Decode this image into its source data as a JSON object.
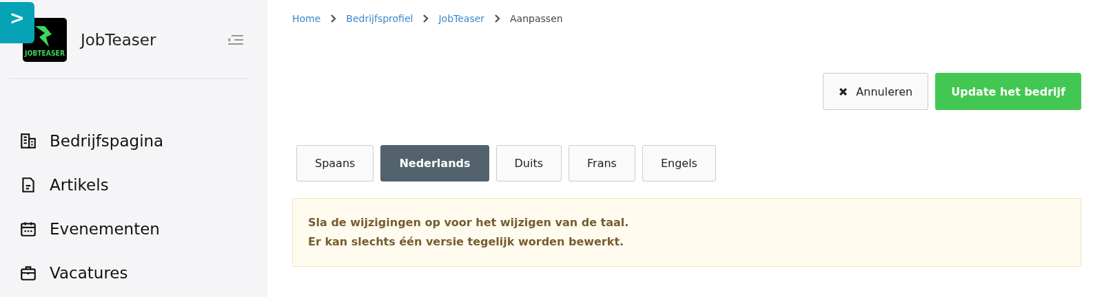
{
  "sidebar": {
    "toggle_button": ">",
    "logo_text": "JOBTEASER",
    "title": "JobTeaser",
    "items": [
      {
        "label": "Bedrijfspagina",
        "kind": "building"
      },
      {
        "label": "Artikels",
        "kind": "document"
      },
      {
        "label": "Evenementen",
        "kind": "calendar"
      },
      {
        "label": "Vacatures",
        "kind": "briefcase"
      }
    ]
  },
  "breadcrumb": [
    {
      "label": "Home",
      "current": false
    },
    {
      "label": "Bedrijfsprofiel",
      "current": false
    },
    {
      "label": "JobTeaser",
      "current": false
    },
    {
      "label": "Aanpassen",
      "current": true
    }
  ],
  "actions": {
    "cancel": "Annuleren",
    "submit": "Update het bedrijf"
  },
  "tabs": [
    {
      "label": "Spaans",
      "selected": false
    },
    {
      "label": "Nederlands",
      "selected": true
    },
    {
      "label": "Duits",
      "selected": false
    },
    {
      "label": "Frans",
      "selected": false
    },
    {
      "label": "Engels",
      "selected": false
    }
  ],
  "alert": {
    "lines": [
      "Sla de wijzigingen op voor het wijzigen van de taal.",
      "Er kan slechts één versie tegelijk worden bewerkt."
    ]
  }
}
